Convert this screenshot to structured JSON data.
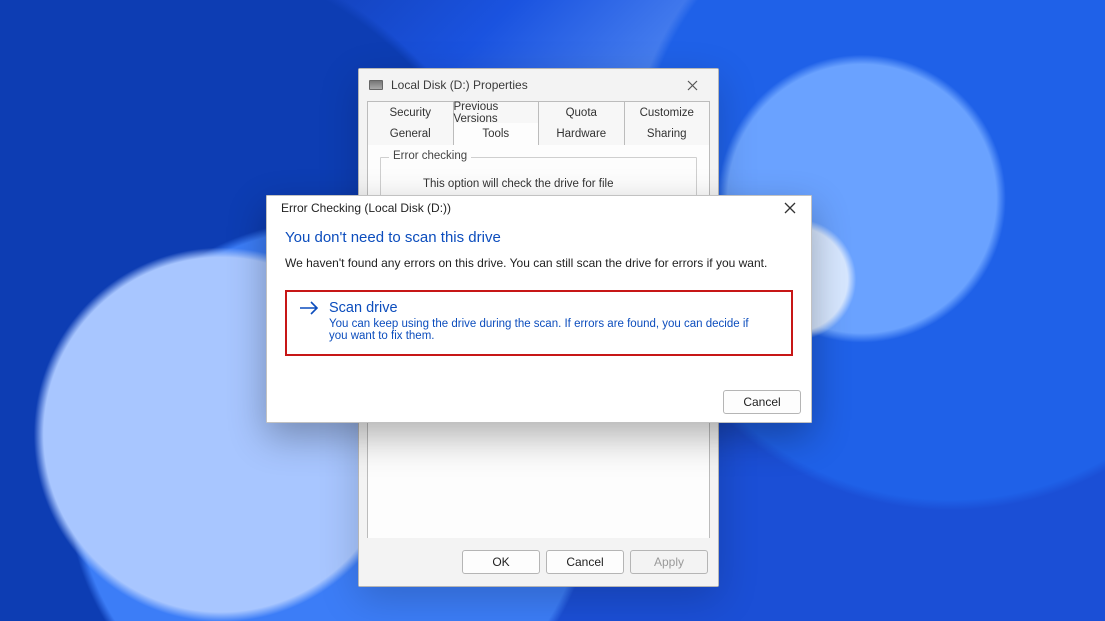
{
  "properties": {
    "window_title": "Local Disk (D:) Properties",
    "tabs_row1": [
      "Security",
      "Previous Versions",
      "Quota",
      "Customize"
    ],
    "tabs_row2": [
      "General",
      "Tools",
      "Hardware",
      "Sharing"
    ],
    "active_tab": "Tools",
    "error_checking": {
      "legend": "Error checking",
      "desc": "This option will check the drive for file"
    },
    "buttons": {
      "ok": "OK",
      "cancel": "Cancel",
      "apply": "Apply"
    }
  },
  "modal": {
    "title": "Error Checking (Local Disk (D:))",
    "headline": "You don't need to scan this drive",
    "subtext": "We haven't found any errors on this drive. You can still scan the drive for errors if you want.",
    "action_title": "Scan drive",
    "action_desc": "You can keep using the drive during the scan. If errors are found, you can decide if you want to fix them.",
    "cancel": "Cancel"
  }
}
